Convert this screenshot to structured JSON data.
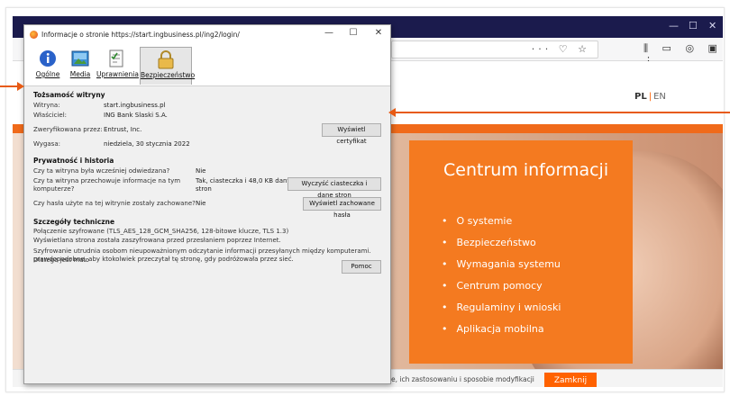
{
  "dialog": {
    "title": "Informacje o stronie https://start.ingbusiness.pl/ing2/login/",
    "controls": {
      "minimize": "—",
      "maximize": "☐",
      "close": "✕"
    },
    "tabs": [
      {
        "label": "Ogólne",
        "icon": "info-icon"
      },
      {
        "label": "Media",
        "icon": "media-icon"
      },
      {
        "label": "Uprawnienia",
        "icon": "permissions-icon"
      },
      {
        "label": "Bezpieczeństwo",
        "icon": "lock-icon"
      }
    ],
    "identity": {
      "heading": "Tożsamość witryny",
      "website_label": "Witryna:",
      "website_value": "start.ingbusiness.pl",
      "owner_label": "Właściciel:",
      "owner_value": "ING Bank Slaski S.A.",
      "verified_label": "Zweryfikowana przez:",
      "verified_value": "Entrust, Inc.",
      "view_cert_button": "Wyświetl certyfikat",
      "expires_label": "Wygasa:",
      "expires_value": "niedziela, 30 stycznia 2022"
    },
    "privacy": {
      "heading": "Prywatność i historia",
      "q1": "Czy ta witryna była wcześniej odwiedzana?",
      "a1": "Nie",
      "q2_line1": "Czy ta witryna przechowuje informacje na tym",
      "q2_line2": "komputerze?",
      "a2_line1": "Tak, ciasteczka i 48,0 KB danych",
      "a2_line2": "stron",
      "clear_button": "Wyczyść ciasteczka i dane stron",
      "q3": "Czy hasła użyte na tej witrynie zostały zachowane?",
      "a3": "Nie",
      "saved_passwords_button": "Wyświetl zachowane hasła"
    },
    "technical": {
      "heading": "Szczegóły techniczne",
      "line1": "Połączenie szyfrowane (TLS_AES_128_GCM_SHA256, 128-bitowe klucze, TLS 1.3)",
      "line2": "Wyświetlana strona została zaszyfrowana przed przesłaniem poprzez Internet.",
      "line3": "Szyfrowanie utrudnia osobom nieupoważnionym odczytanie informacji przesyłanych między komputerami. Dlatego jest mało",
      "line4": "prawdopodobne, aby ktokolwiek przeczytał tę stronę, gdy podróżowała przez sieć.",
      "help_button": "Pomoc"
    }
  },
  "page": {
    "lang_active": "PL",
    "lang_sep": "|",
    "lang_other": "EN",
    "info_title": "Centrum informacji",
    "info_items": [
      "O systemie",
      "Bezpieczeństwo",
      "Wymagania systemu",
      "Centrum pomocy",
      "Regulaminy i wnioski",
      "Aplikacja mobilna"
    ],
    "cookie_text": "e, ich zastosowaniu i sposobie modyfikacji",
    "cookie_close": "Zamknij"
  },
  "colors": {
    "accent": "#ff6200",
    "arrow": "#e75a13",
    "browser_tabbar": "#1b1b4d"
  }
}
